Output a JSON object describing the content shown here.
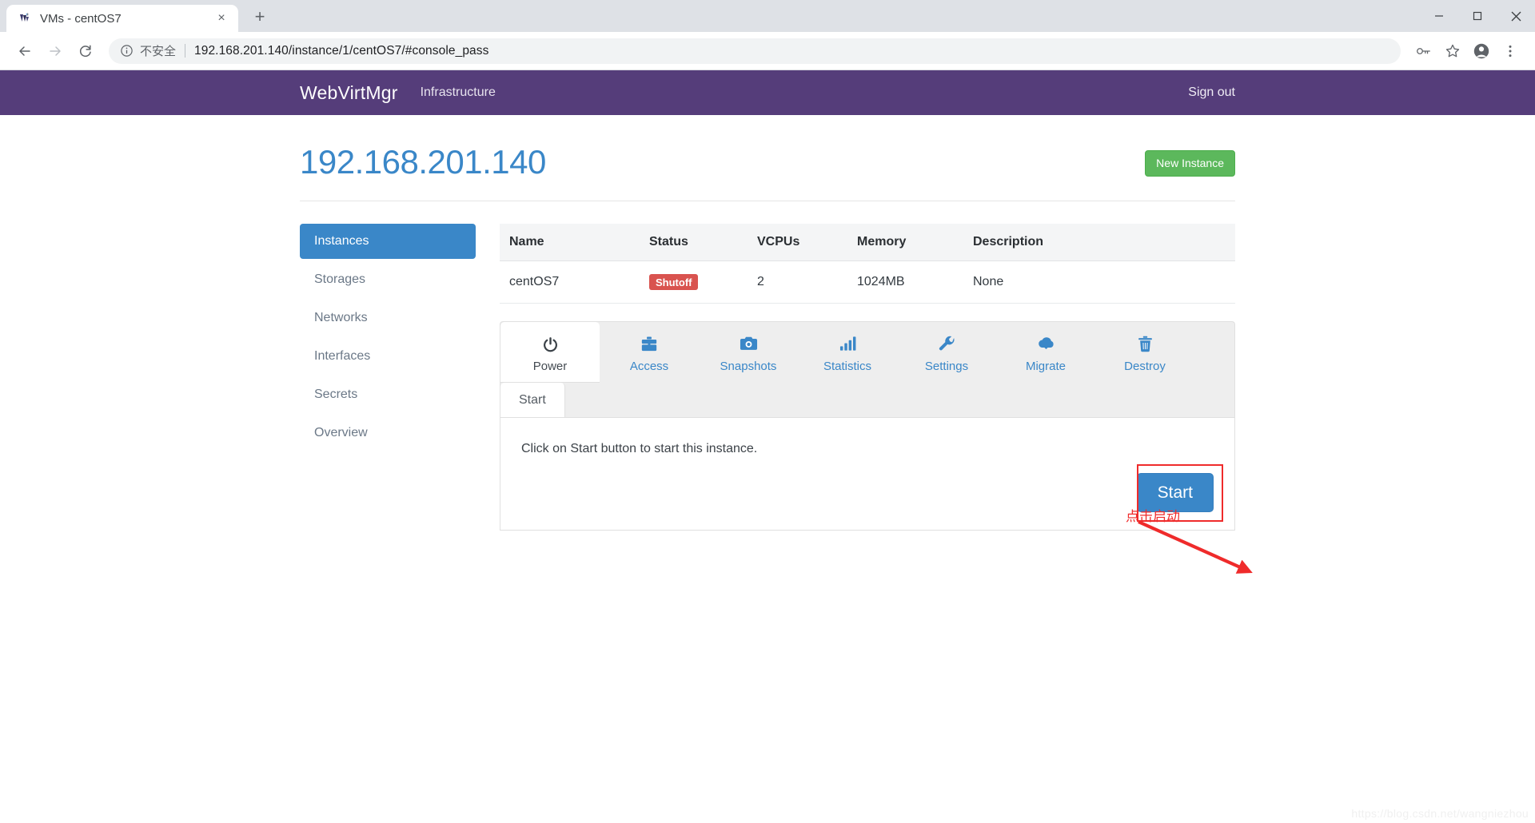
{
  "browser": {
    "tab": {
      "title": "VMs - centOS7",
      "favicon": "webvirtmgr-favicon",
      "close_label": "×"
    },
    "new_tab_label": "+",
    "window_controls": {
      "minimize": "—",
      "maximize": "□",
      "close": "✕"
    },
    "back_label": "←",
    "forward_label": "→",
    "reload_label": "⟳",
    "security_text": "不安全",
    "url_host": "192.168.201.140",
    "url_path": "/instance/1/centOS7/#console_pass",
    "url_full": "192.168.201.140/instance/1/centOS7/#console_pass",
    "toolbar_icons": [
      "key-icon",
      "star-icon",
      "profile-icon",
      "menu-icon"
    ]
  },
  "navbar": {
    "brand": "WebVirtMgr",
    "links": [
      {
        "label": "Infrastructure"
      }
    ],
    "signout": "Sign out",
    "bg_color": "#553d7a"
  },
  "header": {
    "title": "192.168.201.140",
    "title_color": "#3a87c8",
    "new_instance_button": "New Instance",
    "new_instance_color": "#5cb85c"
  },
  "sidebar": {
    "items": [
      {
        "label": "Instances",
        "active": true
      },
      {
        "label": "Storages",
        "active": false
      },
      {
        "label": "Networks",
        "active": false
      },
      {
        "label": "Interfaces",
        "active": false
      },
      {
        "label": "Secrets",
        "active": false
      },
      {
        "label": "Overview",
        "active": false
      }
    ],
    "active_color": "#3a87c8"
  },
  "table": {
    "columns": [
      "Name",
      "Status",
      "VCPUs",
      "Memory",
      "Description"
    ],
    "rows": [
      {
        "name": "centOS7",
        "status": "Shutoff",
        "status_color": "#d9534f",
        "vcpus": "2",
        "memory": "1024MB",
        "description": "None"
      }
    ]
  },
  "tabs": [
    {
      "label": "Power",
      "icon": "power-icon",
      "active": true
    },
    {
      "label": "Access",
      "icon": "briefcase-icon",
      "active": false
    },
    {
      "label": "Snapshots",
      "icon": "camera-icon",
      "active": false
    },
    {
      "label": "Statistics",
      "icon": "bar-chart-icon",
      "active": false
    },
    {
      "label": "Settings",
      "icon": "wrench-icon",
      "active": false
    },
    {
      "label": "Migrate",
      "icon": "cloud-download-icon",
      "active": false
    },
    {
      "label": "Destroy",
      "icon": "trash-icon",
      "active": false
    }
  ],
  "panel": {
    "sub_tab": "Start",
    "text": "Click on Start button to start this instance.",
    "start_button": "Start",
    "start_button_color": "#3a87c8"
  },
  "annotation": {
    "text": "点击启动",
    "color": "#ef2b2b"
  },
  "watermark": "https://blog.csdn.net/wangniezhou"
}
